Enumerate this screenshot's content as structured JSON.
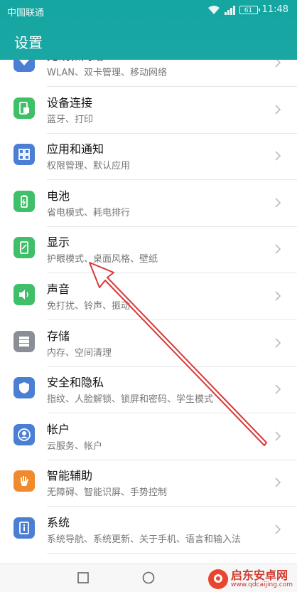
{
  "status_bar": {
    "carrier": "中国联通",
    "battery": "61",
    "time": "11:48"
  },
  "header": {
    "title": "设置"
  },
  "items": [
    {
      "title": "无线和网络",
      "subtitle": "WLAN、双卡管理、移动网络",
      "icon": "wifi-icon",
      "color": "#4a7fd4"
    },
    {
      "title": "设备连接",
      "subtitle": "蓝牙、打印",
      "icon": "device-connect-icon",
      "color": "#3fbf68"
    },
    {
      "title": "应用和通知",
      "subtitle": "权限管理、默认应用",
      "icon": "apps-grid-icon",
      "color": "#4a7fd4"
    },
    {
      "title": "电池",
      "subtitle": "省电模式、耗电排行",
      "icon": "battery-icon",
      "color": "#3fbf68"
    },
    {
      "title": "显示",
      "subtitle": "护眼模式、桌面风格、壁纸",
      "icon": "display-icon",
      "color": "#3fbf68"
    },
    {
      "title": "声音",
      "subtitle": "免打扰、铃声、振动",
      "icon": "speaker-icon",
      "color": "#3fbf68"
    },
    {
      "title": "存储",
      "subtitle": "内存、空间清理",
      "icon": "storage-icon",
      "color": "#8a8f96"
    },
    {
      "title": "安全和隐私",
      "subtitle": "指纹、人脸解锁、锁屏和密码、学生模式",
      "icon": "shield-icon",
      "color": "#4a7fd4"
    },
    {
      "title": "帐户",
      "subtitle": "云服务、帐户",
      "icon": "account-icon",
      "color": "#4a7fd4"
    },
    {
      "title": "智能辅助",
      "subtitle": "无障碍、智能识屏、手势控制",
      "icon": "hand-icon",
      "color": "#f08a2c"
    },
    {
      "title": "系统",
      "subtitle": "系统导航、系统更新、关于手机、语言和输入法",
      "icon": "system-info-icon",
      "color": "#4a7fd4"
    }
  ],
  "watermark": {
    "brand": "启东安卓网",
    "url": "www.qdcaijing.com"
  }
}
